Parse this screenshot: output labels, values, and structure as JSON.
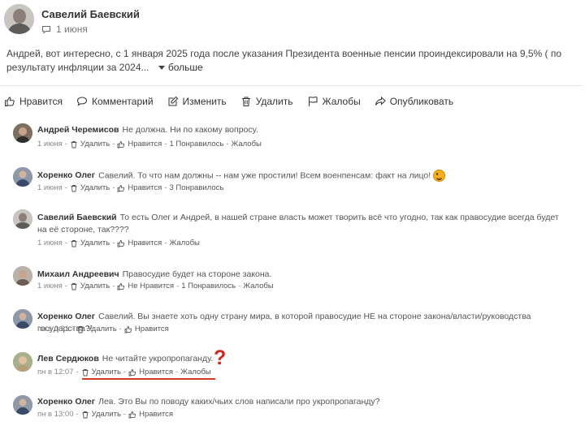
{
  "post": {
    "author": "Савелий Баевский",
    "date": "1 июня",
    "text": "Андрей, вот интересно, с 1 января 2025 года после указания Президента военные пенсии проиндексировали на 9,5% ( по результату инфляции за 2024...",
    "more_label": "больше"
  },
  "actions": [
    {
      "label": "Нравится",
      "icon": "thumb-up-icon"
    },
    {
      "label": "Комментарий",
      "icon": "comment-icon"
    },
    {
      "label": "Изменить",
      "icon": "edit-icon"
    },
    {
      "label": "Удалить",
      "icon": "trash-icon"
    },
    {
      "label": "Жалобы",
      "icon": "flag-icon"
    },
    {
      "label": "Опубликовать",
      "icon": "share-icon"
    }
  ],
  "comments": [
    {
      "author": "Андрей Черемисов",
      "text": "Не должна. Ни по какому вопросу.",
      "date": "1 июня",
      "delete": "Удалить",
      "like": "Нравится",
      "likes": "1 Понравилось",
      "report": "Жалобы"
    },
    {
      "author": "Хоренко Олег",
      "text": "Савелий. То что нам должны -- нам уже простили! Всем военпенсам: факт на лицо!",
      "date": "1 июня",
      "delete": "Удалить",
      "like": "Нравится",
      "likes": "3 Понравилось",
      "report": ""
    },
    {
      "author": "Савелий Баевский",
      "text": "То есть Олег и Андрей, в нашей стране власть может творить всё что угодно, так как правосудие всегда будет на её стороне, так????",
      "date": "1 июня",
      "delete": "Удалить",
      "like": "Нравится",
      "likes": "",
      "report": "Жалобы"
    },
    {
      "author": "Михаил Андреевич",
      "text": "Правосудие будет на стороне закона.",
      "date": "1 июня",
      "delete": "Удалить",
      "like": "Не Нравится",
      "likes": "1 Понравилось",
      "report": "Жалобы"
    },
    {
      "author": "Хоренко Олег",
      "text": "Савелий. Вы знаете хоть одну страну мира, в которой правосудие НЕ на стороне закона/власти/руководства государства?!",
      "date": "пн в 0:21",
      "delete": "Удалить",
      "like": "Нравится",
      "likes": "",
      "report": ""
    },
    {
      "author": "Лев Сердюков",
      "text": "Не читайте укропропаганду.",
      "date": "пн в 12:07",
      "delete": "Удалить",
      "like": "Нравится",
      "likes": "",
      "report": "Жалобы"
    },
    {
      "author": "Хоренко Олег",
      "text": "Лев. Это Вы по поводу каких/чьих слов написали про укропропаганду?",
      "date": "пн в 13:00",
      "delete": "Удалить",
      "like": "Нравится",
      "likes": "",
      "report": ""
    }
  ],
  "annotation": {
    "mark": "?",
    "color": "#d6261c"
  }
}
